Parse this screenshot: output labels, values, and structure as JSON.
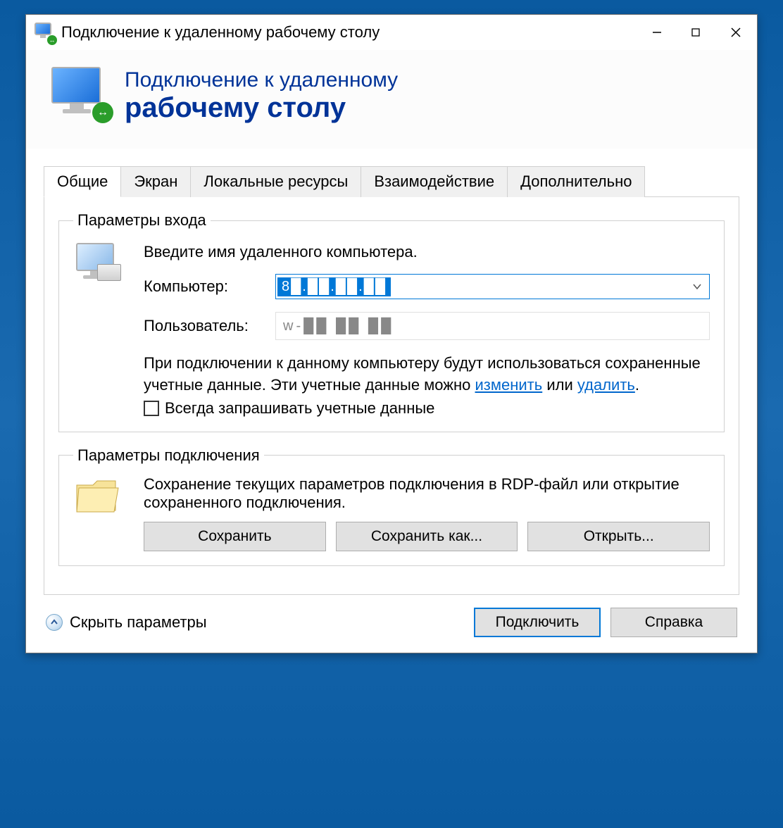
{
  "window": {
    "title": "Подключение к удаленному рабочему столу"
  },
  "header": {
    "line1": "Подключение к удаленному",
    "line2": "рабочему столу"
  },
  "tabs": [
    "Общие",
    "Экран",
    "Локальные ресурсы",
    "Взаимодействие",
    "Дополнительно"
  ],
  "login_group": {
    "legend": "Параметры входа",
    "instruction": "Введите имя удаленного компьютера.",
    "computer_label": "Компьютер:",
    "computer_value": "8█.██.██.██",
    "user_label": "Пользователь:",
    "user_value": "w-██ ██ ██",
    "cred_text_1": "При подключении к данному компьютеру будут использоваться сохраненные учетные данные.  Эти учетные данные можно ",
    "link_edit": "изменить",
    "cred_text_or": " или ",
    "link_delete": "удалить",
    "cred_text_dot": ".",
    "checkbox_label": "Всегда запрашивать учетные данные"
  },
  "conn_group": {
    "legend": "Параметры подключения",
    "desc": "Сохранение текущих параметров подключения в RDP-файл или открытие сохраненного подключения.",
    "save": "Сохранить",
    "save_as": "Сохранить как...",
    "open": "Открыть..."
  },
  "footer": {
    "hide_params": "Скрыть параметры",
    "connect": "Подключить",
    "help": "Справка"
  }
}
